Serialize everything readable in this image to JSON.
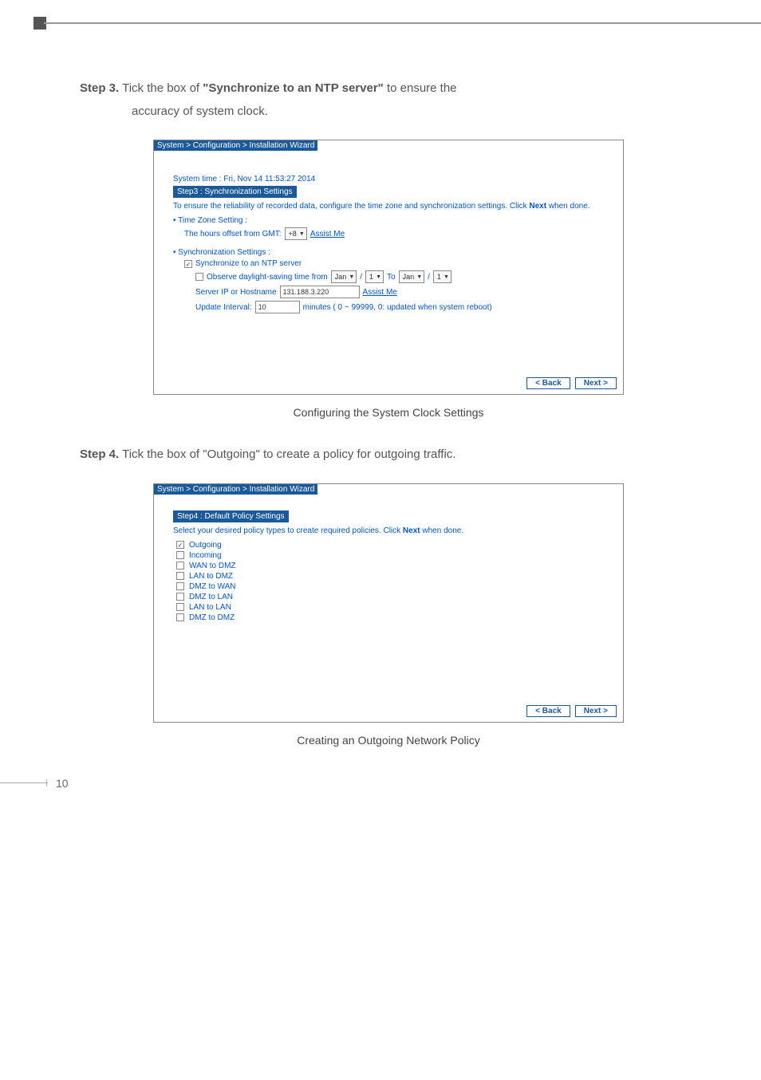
{
  "step3": {
    "label": "Step 3.",
    "text_prefix": "Tick the box of ",
    "highlight": "\"Synchronize to an NTP server\"",
    "text_suffix": " to ensure the",
    "line2": "accuracy of system clock."
  },
  "shot1": {
    "breadcrumb": "System > Configuration > Installation Wizard",
    "systime": "System time : Fri, Nov 14 11:53:27 2014",
    "header": "Step3 : Synchronization Settings",
    "desc": "To ensure the reliability of recorded data, configure the time zone and synchronization settings. Click ",
    "desc_bold": "Next",
    "desc_after": " when done.",
    "tz_bullet": "Time Zone Setting :",
    "tz_line": "The hours offset from GMT:",
    "tz_val": "+8",
    "assist": "Assist Me",
    "sync_bullet": "Synchronization Settings :",
    "sync_check": "Synchronize to an NTP server",
    "daylight": "Observe daylight-saving time from",
    "to": "To",
    "jan": "Jan",
    "one": "1",
    "server_label": "Server IP or Hostname",
    "server_val": "131.188.3.220",
    "update_label": "Update Interval:",
    "update_val": "10",
    "update_suffix": "minutes  ( 0 ~ 99999, 0: updated when system reboot)",
    "back": "< Back",
    "next": "Next >"
  },
  "caption1": "Configuring the System Clock Settings",
  "step4": {
    "label": "Step 4.",
    "text": "Tick the box of \"Outgoing\" to create a policy for outgoing traffic."
  },
  "shot2": {
    "breadcrumb": "System > Configuration > Installation Wizard",
    "header": "Step4 : Default Policy Settings",
    "desc": "Select your desired policy types to create required policies. Click ",
    "desc_bold": "Next",
    "desc_after": " when done.",
    "policies": [
      {
        "label": "Outgoing",
        "checked": true
      },
      {
        "label": "Incoming",
        "checked": false
      },
      {
        "label": "WAN to DMZ",
        "checked": false
      },
      {
        "label": "LAN to DMZ",
        "checked": false
      },
      {
        "label": "DMZ to WAN",
        "checked": false
      },
      {
        "label": "DMZ to LAN",
        "checked": false
      },
      {
        "label": "LAN to LAN",
        "checked": false
      },
      {
        "label": "DMZ to DMZ",
        "checked": false
      }
    ],
    "back": "< Back",
    "next": "Next >"
  },
  "caption2": "Creating an Outgoing Network Policy",
  "page_num": "10"
}
